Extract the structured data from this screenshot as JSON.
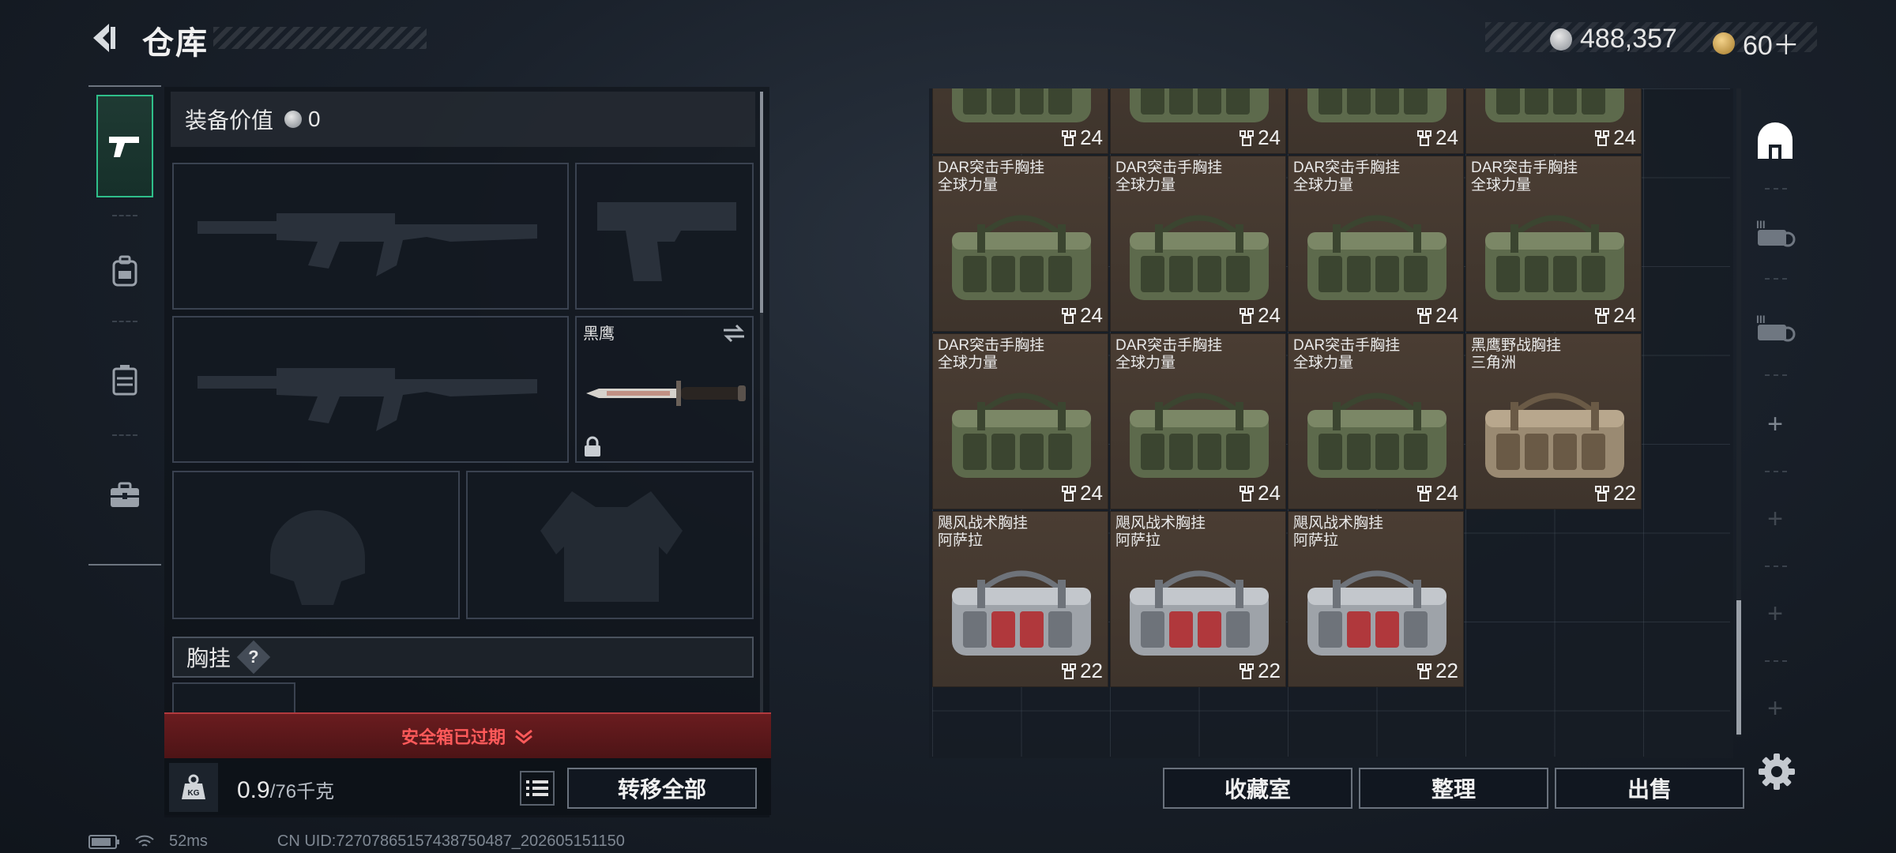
{
  "header": {
    "title": "仓库",
    "currency_silver": "488,357",
    "currency_gold": "60＋"
  },
  "rail": {
    "tabs": [
      {
        "icon": "pistol-icon",
        "active": true
      },
      {
        "icon": "backpack-icon",
        "active": false
      },
      {
        "icon": "vest-icon",
        "active": false
      },
      {
        "icon": "toolbox-icon",
        "active": false
      }
    ]
  },
  "loadout": {
    "value_label": "装备价值",
    "value_amount": "0",
    "knife_label": "黑鹰",
    "vest_header": "胸挂",
    "vest_help": "?",
    "expired_label": "安全箱已过期",
    "weight_value": "0.9",
    "weight_max": "/76千克",
    "transfer_all": "转移全部"
  },
  "inventory": {
    "items": [
      {
        "line1": "",
        "line2": "",
        "capacity": "24",
        "variant": "green"
      },
      {
        "line1": "",
        "line2": "",
        "capacity": "24",
        "variant": "green"
      },
      {
        "line1": "",
        "line2": "",
        "capacity": "24",
        "variant": "green"
      },
      {
        "line1": "",
        "line2": "",
        "capacity": "24",
        "variant": "green"
      },
      {
        "line1": "DAR突击手胸挂",
        "line2": "全球力量",
        "capacity": "24",
        "variant": "green"
      },
      {
        "line1": "DAR突击手胸挂",
        "line2": "全球力量",
        "capacity": "24",
        "variant": "green"
      },
      {
        "line1": "DAR突击手胸挂",
        "line2": "全球力量",
        "capacity": "24",
        "variant": "green"
      },
      {
        "line1": "DAR突击手胸挂",
        "line2": "全球力量",
        "capacity": "24",
        "variant": "green"
      },
      {
        "line1": "DAR突击手胸挂",
        "line2": "全球力量",
        "capacity": "24",
        "variant": "green"
      },
      {
        "line1": "DAR突击手胸挂",
        "line2": "全球力量",
        "capacity": "24",
        "variant": "green"
      },
      {
        "line1": "DAR突击手胸挂",
        "line2": "全球力量",
        "capacity": "24",
        "variant": "green"
      },
      {
        "line1": "黑鹰野战胸挂",
        "line2": "三角洲",
        "capacity": "22",
        "variant": "tan"
      },
      {
        "line1": "飓风战术胸挂",
        "line2": "阿萨拉",
        "capacity": "22",
        "variant": "grey"
      },
      {
        "line1": "飓风战术胸挂",
        "line2": "阿萨拉",
        "capacity": "22",
        "variant": "grey"
      },
      {
        "line1": "飓风战术胸挂",
        "line2": "阿萨拉",
        "capacity": "22",
        "variant": "grey"
      }
    ],
    "buttons": {
      "collection": "收藏室",
      "sort": "整理",
      "sell": "出售"
    }
  },
  "status_bar": {
    "ping": "52ms",
    "uid": "CN UID:72707865157438750487_202605151150"
  },
  "colors": {
    "accent_green": "#2fbf8a",
    "expired_red": "#ff5a5a",
    "item_bg": "#4a3d33"
  }
}
